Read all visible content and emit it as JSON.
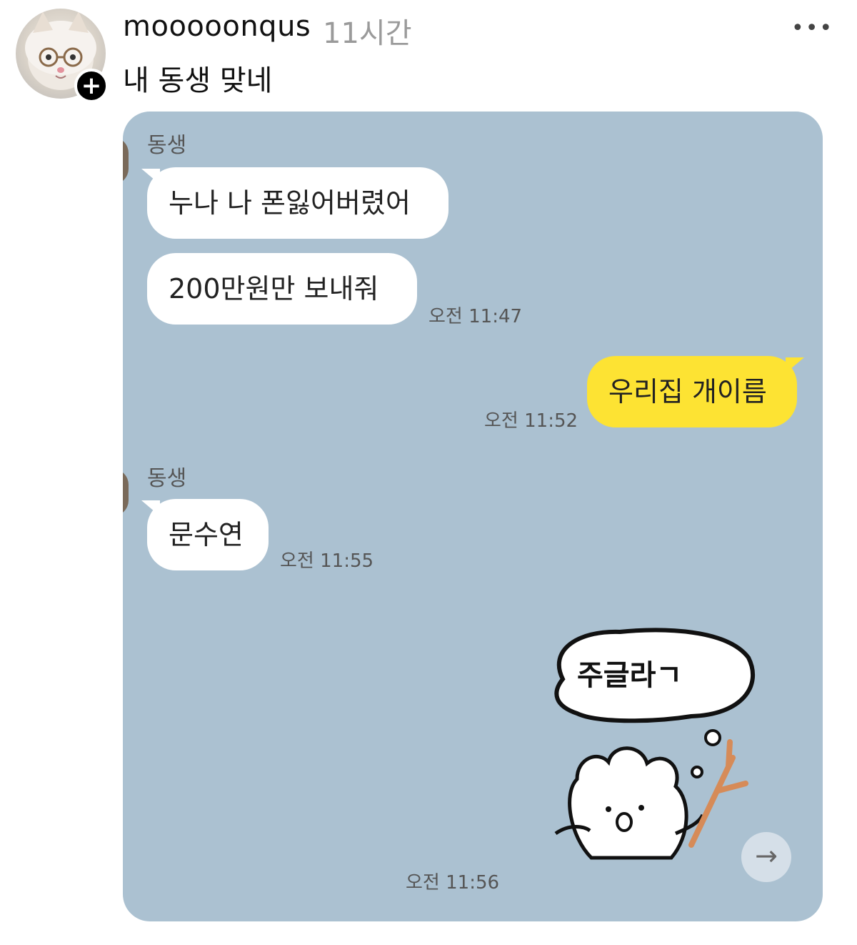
{
  "post": {
    "username": "mooooonqus",
    "timestamp": "11시간",
    "caption": "내 동생 맞네",
    "follow_icon": "plus-icon",
    "more_icon": "more-horizontal-icon"
  },
  "chat": {
    "groups": [
      {
        "sender": "동생"
      },
      {
        "sender": "동생"
      }
    ],
    "messages": [
      {
        "text": "누나 나 폰잃어버렸어",
        "direction": "incoming"
      },
      {
        "text": "200만원만 보내줘",
        "direction": "incoming",
        "time": "오전 11:47"
      },
      {
        "text": "우리집 개이름",
        "direction": "outgoing",
        "time": "오전 11:52"
      },
      {
        "text": "문수연",
        "direction": "incoming",
        "time": "오전 11:55"
      }
    ],
    "sticker": {
      "text": "주글라ㄱ",
      "time": "오전 11:56"
    },
    "colors": {
      "background": "#abc1d1",
      "outgoing_bubble": "#fde333",
      "incoming_bubble": "#ffffff"
    }
  },
  "next_icon": "arrow-right-icon"
}
